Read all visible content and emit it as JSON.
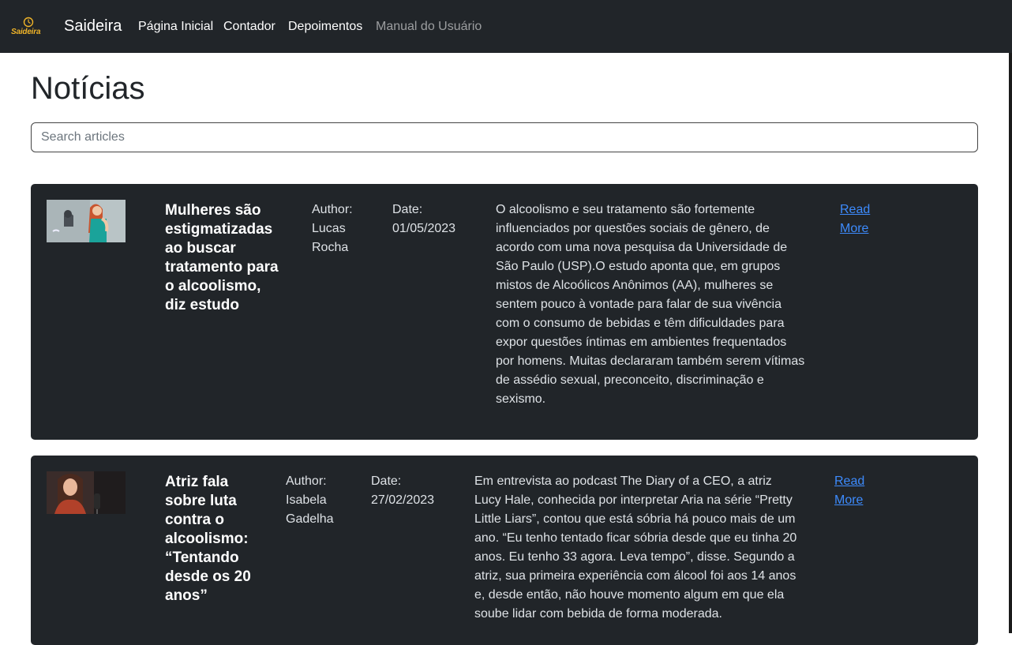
{
  "nav": {
    "logo_text": "Saideira",
    "brand": "Saideira",
    "links": [
      "Página Inicial",
      "Contador",
      "Depoimentos",
      "Manual do Usuário"
    ]
  },
  "page": {
    "title": "Notícias",
    "search_placeholder": "Search articles"
  },
  "articles": [
    {
      "title": "Mulheres são estigmatizadas ao buscar tratamento para o alcoolismo, diz estudo",
      "author_label": "Author:",
      "author": "Lucas Rocha",
      "date_label": "Date:",
      "date": "01/05/2023",
      "summary": "O alcoolismo e seu tratamento são fortemente influenciados por questões sociais de gênero, de acordo com uma nova pesquisa da Universidade de São Paulo (USP).O estudo aponta que, em grupos mistos de Alcoólicos Anônimos (AA), mulheres se sentem pouco à vontade para falar de sua vivência com o consumo de bebidas e têm dificuldades para expor questões íntimas em ambientes frequentados por homens. Muitas declararam também serem vítimas de assédio sexual, preconceito, discriminação e sexismo.",
      "link": "Read More"
    },
    {
      "title": "Atriz fala sobre luta contra o alcoolismo: “Tentando desde os 20 anos”",
      "author_label": "Author:",
      "author": "Isabela Gadelha",
      "date_label": "Date:",
      "date": "27/02/2023",
      "summary": "Em entrevista ao podcast The Diary of a CEO, a atriz Lucy Hale, conhecida por interpretar Aria na série “Pretty Little Liars”, contou que está sóbria há pouco mais de um ano. “Eu tenho tentado ficar sóbria desde que eu tinha 20 anos. Eu tenho 33 agora. Leva tempo”, disse. Segundo a atriz, sua primeira experiência com álcool foi aos 14 anos e, desde então, não houve momento algum em que ela soube lidar com bebida de forma moderada.",
      "link": "Read More"
    }
  ]
}
